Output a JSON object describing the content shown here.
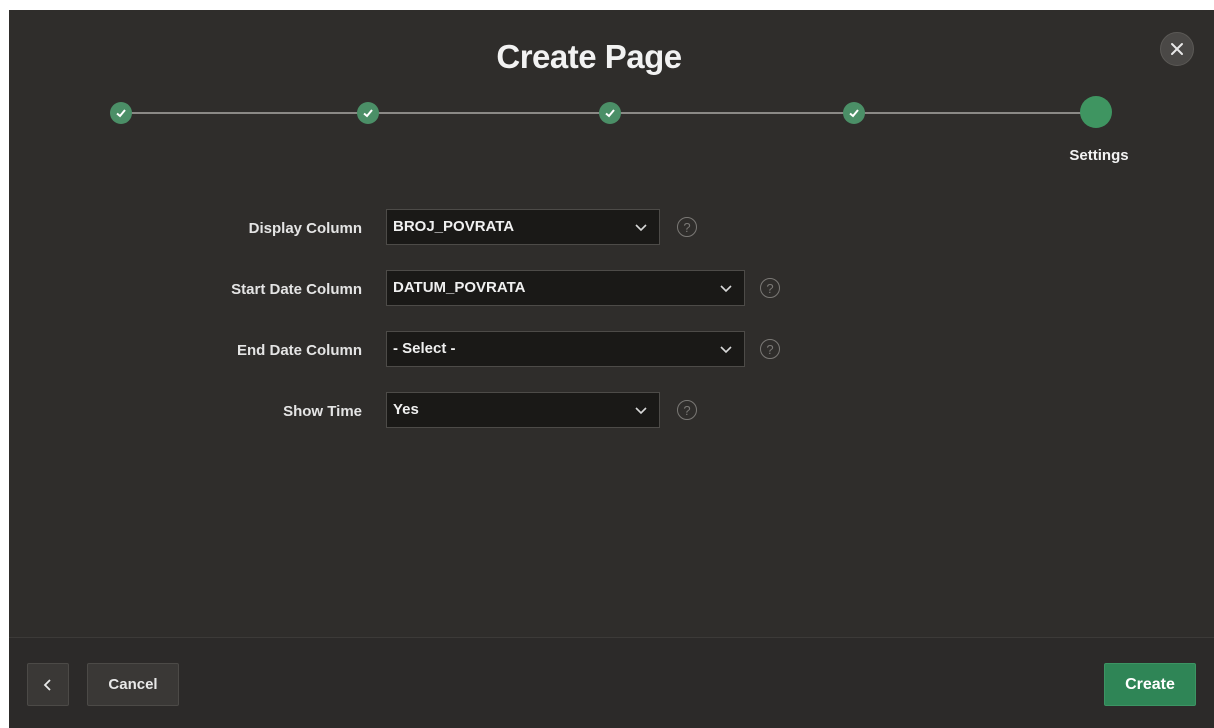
{
  "dialog": {
    "title": "Create Page"
  },
  "wizard": {
    "steps": [
      {
        "state": "complete"
      },
      {
        "state": "complete"
      },
      {
        "state": "complete"
      },
      {
        "state": "complete"
      },
      {
        "state": "current",
        "label": "Settings"
      }
    ]
  },
  "form": {
    "display_column": {
      "label": "Display Column",
      "value": "BROJ_POVRATA"
    },
    "start_date_column": {
      "label": "Start Date Column",
      "value": "DATUM_POVRATA"
    },
    "end_date_column": {
      "label": "End Date Column",
      "value": "- Select -"
    },
    "show_time": {
      "label": "Show Time",
      "value": "Yes"
    }
  },
  "footer": {
    "back_icon": "chevron-left-icon",
    "cancel_label": "Cancel",
    "create_label": "Create"
  },
  "colors": {
    "dialog_bg": "#2f2d2b",
    "accent_green": "#2f8556"
  }
}
